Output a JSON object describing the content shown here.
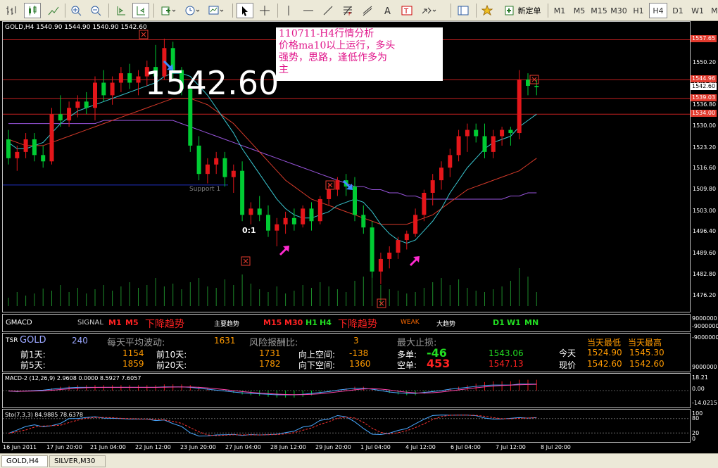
{
  "toolbar": {
    "new_order_label": "新定单",
    "timeframes": [
      "M1",
      "M5",
      "M15",
      "M30",
      "H1",
      "H4",
      "D1",
      "W1",
      "MN"
    ],
    "active_timeframe": "H4"
  },
  "main_chart": {
    "header": "GOLD,H4  1540.90 1544.90 1540.90 1542.60",
    "big_price": "1542.60",
    "note_lines": [
      "110711-H4行情分析",
      "价格ma10以上运行，多头",
      "强势，思路，逢低作多为",
      "主"
    ],
    "support_label": "Support 1",
    "ratio_label": "0:1",
    "price_axis": [
      "1550.20",
      "1543.50",
      "1536.80",
      "1530.00",
      "1523.20",
      "1516.60",
      "1509.80",
      "1503.00",
      "1496.40",
      "1489.60",
      "1482.80",
      "1476.20"
    ],
    "price_tags": [
      {
        "text": "1557.65",
        "color": "#e33b2e"
      },
      {
        "text": "1544.96",
        "color": "#e33b2e"
      },
      {
        "text": "1542.60",
        "color": "#ffffff"
      },
      {
        "text": "1539.03",
        "color": "#e33b2e"
      },
      {
        "text": "1534.00",
        "color": "#e33b2e"
      }
    ],
    "candles": [
      [
        1526,
        1529,
        1518,
        1520
      ],
      [
        1520,
        1524,
        1516,
        1522
      ],
      [
        1522,
        1528,
        1520,
        1526
      ],
      [
        1526,
        1528,
        1519,
        1521
      ],
      [
        1521,
        1524,
        1517,
        1519
      ],
      [
        1519,
        1536,
        1518,
        1534
      ],
      [
        1534,
        1540,
        1530,
        1532
      ],
      [
        1532,
        1538,
        1530,
        1536
      ],
      [
        1536,
        1540,
        1533,
        1538
      ],
      [
        1538,
        1541,
        1534,
        1536
      ],
      [
        1536,
        1546,
        1532,
        1544
      ],
      [
        1544,
        1548,
        1538,
        1540
      ],
      [
        1540,
        1546,
        1537,
        1544
      ],
      [
        1544,
        1549,
        1541,
        1547
      ],
      [
        1547,
        1550,
        1542,
        1544
      ],
      [
        1544,
        1548,
        1540,
        1546
      ],
      [
        1546,
        1551,
        1543,
        1549
      ],
      [
        1549,
        1556,
        1544,
        1546
      ],
      [
        1546,
        1558,
        1545,
        1555
      ],
      [
        1555,
        1557,
        1545,
        1548
      ],
      [
        1548,
        1549,
        1540,
        1542
      ],
      [
        1542,
        1544,
        1522,
        1524
      ],
      [
        1524,
        1527,
        1513,
        1515
      ],
      [
        1515,
        1520,
        1512,
        1518
      ],
      [
        1518,
        1522,
        1515,
        1520
      ],
      [
        1520,
        1522,
        1511,
        1514
      ],
      [
        1514,
        1518,
        1509,
        1516
      ],
      [
        1516,
        1519,
        1500,
        1502
      ],
      [
        1502,
        1506,
        1499,
        1504
      ],
      [
        1504,
        1508,
        1500,
        1502
      ],
      [
        1502,
        1505,
        1495,
        1497
      ],
      [
        1497,
        1501,
        1492,
        1499
      ],
      [
        1499,
        1503,
        1496,
        1501
      ],
      [
        1501,
        1504,
        1497,
        1499
      ],
      [
        1499,
        1505,
        1498,
        1504
      ],
      [
        1504,
        1506,
        1497,
        1500
      ],
      [
        1500,
        1508,
        1499,
        1507
      ],
      [
        1507,
        1512,
        1505,
        1510
      ],
      [
        1510,
        1514,
        1508,
        1513
      ],
      [
        1513,
        1515,
        1508,
        1511
      ],
      [
        1511,
        1514,
        1500,
        1502
      ],
      [
        1502,
        1505,
        1496,
        1498
      ],
      [
        1498,
        1500,
        1482,
        1484
      ],
      [
        1484,
        1490,
        1480,
        1488
      ],
      [
        1488,
        1492,
        1485,
        1490
      ],
      [
        1490,
        1495,
        1488,
        1494
      ],
      [
        1494,
        1497,
        1491,
        1496
      ],
      [
        1496,
        1504,
        1495,
        1502
      ],
      [
        1502,
        1510,
        1500,
        1509
      ],
      [
        1509,
        1515,
        1505,
        1513
      ],
      [
        1513,
        1519,
        1510,
        1517
      ],
      [
        1517,
        1523,
        1514,
        1521
      ],
      [
        1521,
        1529,
        1519,
        1527
      ],
      [
        1527,
        1531,
        1522,
        1529
      ],
      [
        1529,
        1531,
        1525,
        1527
      ],
      [
        1527,
        1531,
        1520,
        1522
      ],
      [
        1522,
        1529,
        1520,
        1527
      ],
      [
        1527,
        1530,
        1524,
        1529
      ],
      [
        1529,
        1530,
        1524,
        1528
      ],
      [
        1528,
        1548,
        1526,
        1545
      ],
      [
        1545,
        1547,
        1540,
        1543
      ],
      [
        1543,
        1545,
        1540,
        1542.6
      ]
    ],
    "volumes": [
      12,
      20,
      15,
      18,
      25,
      22,
      30,
      20,
      26,
      18,
      24,
      30,
      22,
      28,
      34,
      26,
      30,
      40,
      28,
      32,
      24,
      34,
      40,
      28,
      26,
      38,
      30,
      45,
      32,
      24,
      20,
      28,
      18,
      22,
      30,
      26,
      34,
      28,
      24,
      20,
      36,
      42,
      50,
      30,
      24,
      22,
      18,
      20,
      26,
      34,
      40,
      30,
      38,
      26,
      22,
      20,
      24,
      28,
      36,
      54,
      42,
      20
    ],
    "ma_fast": [
      1525,
      1523,
      1523,
      1524,
      1525,
      1528,
      1531,
      1533,
      1535,
      1536,
      1537,
      1538,
      1539,
      1540,
      1541,
      1542,
      1543,
      1544,
      1546,
      1547,
      1547,
      1546,
      1543,
      1540,
      1536,
      1532,
      1528,
      1523,
      1519,
      1515,
      1511,
      1507,
      1504,
      1502,
      1501,
      1501,
      1502,
      1503,
      1505,
      1506,
      1507,
      1506,
      1503,
      1499,
      1496,
      1494,
      1493,
      1494,
      1497,
      1500,
      1504,
      1509,
      1513,
      1517,
      1520,
      1523,
      1525,
      1526,
      1527,
      1530,
      1532,
      1534
    ],
    "ma_mid": [
      1526,
      1525,
      1524,
      1524,
      1524,
      1525,
      1526,
      1527,
      1528,
      1529,
      1530,
      1531,
      1532,
      1533,
      1534,
      1535,
      1536,
      1537,
      1538,
      1539,
      1539,
      1539,
      1538,
      1537,
      1535,
      1533,
      1531,
      1528,
      1525,
      1522,
      1519,
      1516,
      1513,
      1511,
      1509,
      1507,
      1506,
      1505,
      1504,
      1503,
      1502,
      1501,
      1500,
      1499,
      1499,
      1499,
      1499,
      1500,
      1501,
      1502,
      1504,
      1506,
      1508,
      1510,
      1511,
      1512,
      1513,
      1514,
      1515,
      1516,
      1518,
      1520
    ],
    "ma_slow": [
      1531,
      1531,
      1531,
      1531,
      1531,
      1531,
      1531,
      1531,
      1531,
      1531,
      1531,
      1532,
      1532,
      1532,
      1532,
      1532,
      1532,
      1532,
      1532,
      1532,
      1531,
      1530,
      1529,
      1528,
      1527,
      1526,
      1525,
      1524,
      1523,
      1522,
      1521,
      1520,
      1519,
      1518,
      1517,
      1516,
      1515,
      1514,
      1513,
      1512,
      1511,
      1511,
      1510,
      1510,
      1509,
      1509,
      1508,
      1508,
      1507,
      1507,
      1507,
      1507,
      1507,
      1507,
      1507,
      1507,
      1507,
      1507,
      1508,
      1508,
      1509,
      1509
    ],
    "y_range": [
      1473,
      1562
    ]
  },
  "signal_panel": {
    "title": "GMACD",
    "signal_label": "SIGNAL",
    "m1": "M1",
    "m5": "M5",
    "trend1": "下降趋势",
    "main_trend_label": "主要趋势",
    "m15": "M15",
    "m30": "M30",
    "h1": "H1",
    "h4": "H4",
    "trend2": "下降趋势",
    "weak": "WEAK",
    "big_trend_label": "大趋势",
    "d1": "D1",
    "w1": "W1",
    "mn": "MN",
    "axis": [
      "9000000",
      "-9000000"
    ]
  },
  "tsr_panel": {
    "tsr_label": "TSR",
    "symbol": "GOLD",
    "value240": "240",
    "avg_label": "每天平均波动:",
    "avg_value": "1631",
    "risk_label": "风险报酬比:",
    "risk_value": "3",
    "maxloss_label": "最大止损:",
    "d1_label": "前1天:",
    "d1_value": "1154",
    "d10_label": "前10天:",
    "d10_value": "1731",
    "up_label": "向上空间:",
    "up_value": "-138",
    "long_label": "多单:",
    "long_value": "-46",
    "long_price": "1543.06",
    "d5_label": "前5天:",
    "d5_value": "1859",
    "d20_label": "前20天:",
    "d20_value": "1782",
    "down_label": "向下空间:",
    "down_value": "1360",
    "short_label": "空单:",
    "short_value": "453",
    "short_price": "1547.13",
    "today_label": "今天",
    "current_label": "现价",
    "low_label": "当天最低",
    "high_label": "当天最高",
    "today_low": "1524.90",
    "today_high": "1545.30",
    "cur_low": "1542.60",
    "cur_high": "1542.60",
    "axis": [
      "-9000000",
      "9000000"
    ]
  },
  "macd_panel": {
    "header": "MACD-2 (12,26,9) 2.9608 0.0000 8.5927 7.6057",
    "axis": [
      "18.21",
      "0.00",
      "-14.0215"
    ]
  },
  "stoch_panel": {
    "header": "Sto(7,3,3) 84.9885 78.6378",
    "axis": [
      "100",
      "80",
      "20",
      "0"
    ]
  },
  "time_axis": [
    "16 Jun 2011",
    "17 Jun 20:00",
    "21 Jun 04:00",
    "22 Jun 12:00",
    "23 Jun 20:00",
    "27 Jun 04:00",
    "28 Jun 12:00",
    "29 Jun 20:00",
    "1 Jul 04:00",
    "4 Jul 12:00",
    "6 Jul 04:00",
    "7 Jul 12:00",
    "8 Jul 20:00"
  ],
  "bottom_tabs": [
    "GOLD,H4",
    "SILVER,M30"
  ],
  "colors": {
    "up": "#e4161a",
    "down": "#00cc33",
    "ma_fast": "#39c6d0",
    "ma_mid": "#d63a2a",
    "ma_slow": "#9955dd",
    "magenta": "#ff2bd0",
    "blue_arrow": "#3a8fff"
  }
}
